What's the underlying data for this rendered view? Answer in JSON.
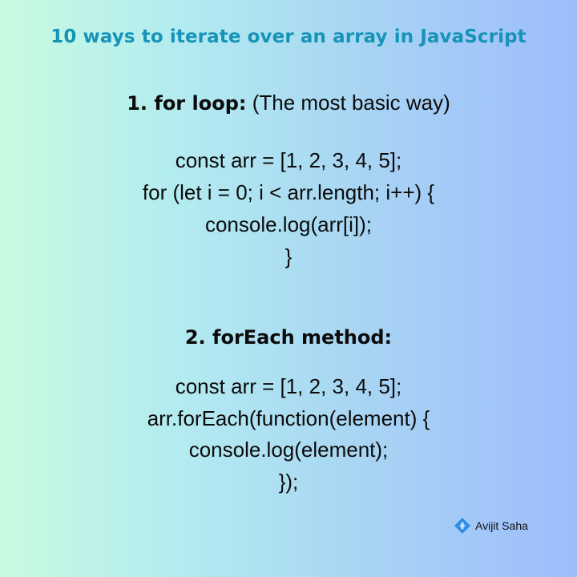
{
  "title": "10 ways to iterate over an array in JavaScript",
  "sections": [
    {
      "heading": "1. for loop:",
      "description": "(The most basic way)",
      "code": [
        "const arr = [1, 2, 3, 4, 5];",
        "for (let i = 0; i < arr.length; i++) {",
        "console.log(arr[i]);",
        "}"
      ]
    },
    {
      "heading": "2. forEach method:",
      "description": "",
      "code": [
        "const arr = [1, 2, 3, 4, 5];",
        "arr.forEach(function(element) {",
        "console.log(element);",
        "});"
      ]
    }
  ],
  "watermark": {
    "author": "Avijit Saha",
    "icon": "diamond-logo-icon"
  },
  "colors": {
    "title": "#1694b7",
    "logo": "#2f8de4"
  }
}
